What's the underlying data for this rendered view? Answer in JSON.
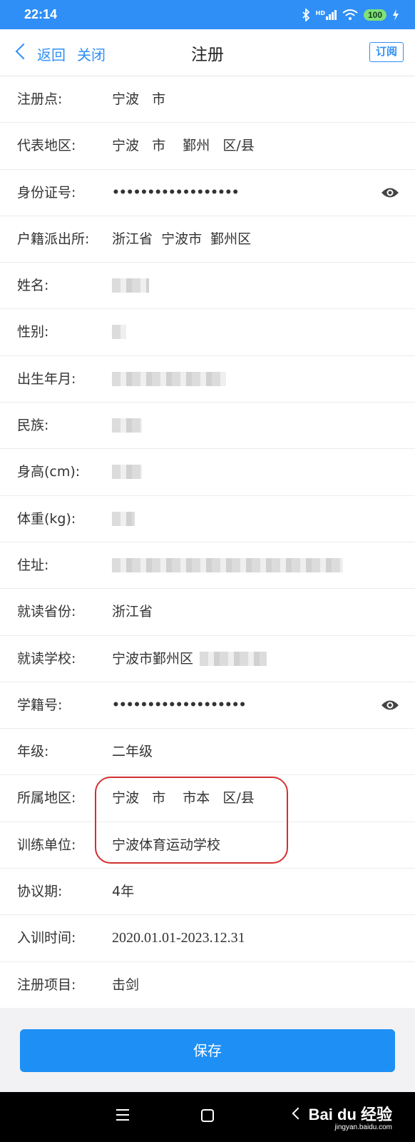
{
  "status": {
    "time": "22:14",
    "battery": "100",
    "hd": "HD"
  },
  "nav": {
    "back": "返回",
    "close": "关闭",
    "title": "注册",
    "subscribe": "订阅"
  },
  "form": {
    "rows": [
      {
        "label": "注册点:",
        "value": "宁波   市"
      },
      {
        "label": "代表地区:",
        "value": "宁波   市    鄞州   区/县"
      },
      {
        "label": "身份证号:",
        "value": "••••••••••••••••••"
      },
      {
        "label": "户籍派出所:",
        "value": "浙江省  宁波市  鄞州区"
      },
      {
        "label": "姓名:",
        "value": ""
      },
      {
        "label": "性别:",
        "value": ""
      },
      {
        "label": "出生年月:",
        "value": ""
      },
      {
        "label": "民族:",
        "value": ""
      },
      {
        "label": "身高(cm):",
        "value": ""
      },
      {
        "label": "体重(kg):",
        "value": ""
      },
      {
        "label": "住址:",
        "value": ""
      },
      {
        "label": "就读省份:",
        "value": "浙江省"
      },
      {
        "label": "就读学校:",
        "value": "宁波市鄞州区"
      },
      {
        "label": "学籍号:",
        "value": "•••••••••••••••••••"
      },
      {
        "label": "年级:",
        "value": "二年级"
      },
      {
        "label": "所属地区:",
        "value": "宁波   市    市本   区/县"
      },
      {
        "label": "训练单位:",
        "value": "宁波体育运动学校"
      },
      {
        "label": "协议期:",
        "value": "4年"
      },
      {
        "label": "入训时间:",
        "value": "2020.01.01-2023.12.31"
      },
      {
        "label": "注册项目:",
        "value": "击剑"
      }
    ]
  },
  "footer": {
    "save": "保存"
  },
  "watermark": {
    "brand": "Bai du 经验",
    "site": "jingyan.baidu.com"
  },
  "colors": {
    "accent": "#2f8ff6",
    "highlight": "#d0312d",
    "button": "#1e8ff5"
  }
}
